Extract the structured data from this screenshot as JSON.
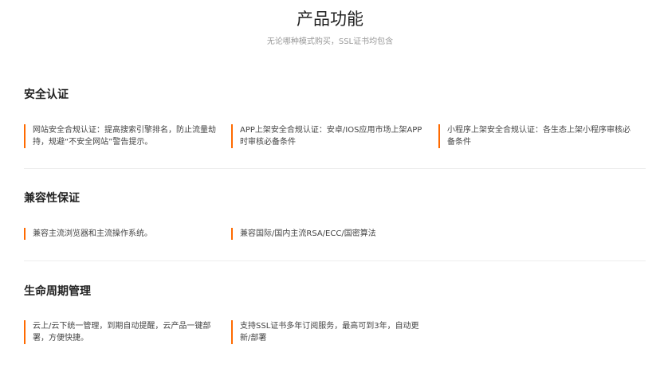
{
  "header": {
    "title": "产品功能",
    "subtitle": "无论哪种模式购买，SSL证书均包含"
  },
  "sections": [
    {
      "title": "安全认证",
      "features": [
        "网站安全合规认证：提高搜索引擎排名，防止流量劫持，规避“不安全网站”警告提示。",
        "APP上架安全合规认证：安卓/IOS应用市场上架APP时审核必备条件",
        "小程序上架安全合规认证：各生态上架小程序审核必备条件"
      ]
    },
    {
      "title": "兼容性保证",
      "features": [
        "兼容主流浏览器和主流操作系统。",
        "兼容国际/国内主流RSA/ECC/国密算法"
      ]
    },
    {
      "title": "生命周期管理",
      "features": [
        "云上/云下统一管理，到期自动提醒，云产品一键部署，方便快捷。",
        "支持SSL证书多年订阅服务，最高可到3年，自动更新/部署"
      ]
    }
  ],
  "colors": {
    "accent": "#ff6a00"
  }
}
